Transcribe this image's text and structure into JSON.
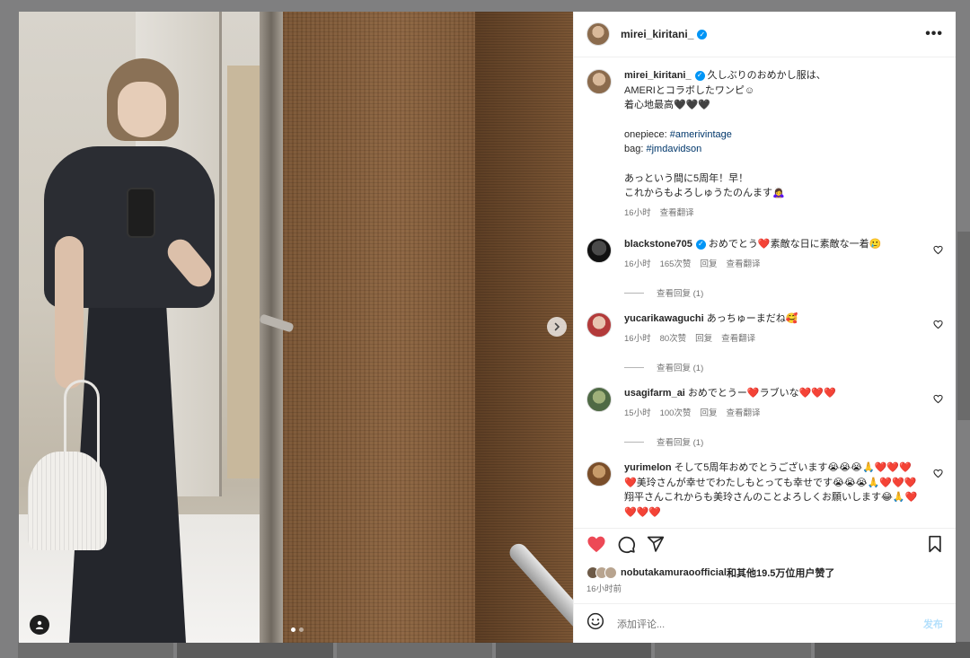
{
  "post": {
    "username": "mirei_kiritani_",
    "caption_lines": [
      "久しぶりのおめかし服は、",
      "AMERIとコラボしたワンピ☺︎",
      "着心地最高🖤🖤🖤"
    ],
    "credits": [
      {
        "label": "onepiece:",
        "tag": "#amerivintage"
      },
      {
        "label": "bag:",
        "tag": "#jmdavidson"
      }
    ],
    "caption_tail": [
      "あっという間に5周年！早！",
      "これからもよろしゅうたのんます🙇‍♀️"
    ],
    "caption_time": "16小时",
    "translate": "查看翻译",
    "likes_by": "nobutakamuraoofficial",
    "likes_rest": "和其他19.5万位用户赞了",
    "post_time": "16小时前"
  },
  "comments": [
    {
      "user": "blackstone705",
      "verified": true,
      "text": "おめでとう❤️素敵な日に素敵な一着🥲",
      "time": "16小时",
      "likes": "165次赞",
      "reply": "回复",
      "translate": "查看翻译",
      "view_replies": "查看回复 (1)"
    },
    {
      "user": "yucarikawaguchi",
      "verified": false,
      "text": "あっちゅーまだね🥰",
      "time": "16小时",
      "likes": "80次赞",
      "reply": "回复",
      "translate": "查看翻译",
      "view_replies": "查看回复 (1)"
    },
    {
      "user": "usagifarm_ai",
      "verified": false,
      "text": "おめでとうー❤️ラブいな❤️❤️❤️",
      "time": "15小时",
      "likes": "100次赞",
      "reply": "回复",
      "translate": "查看翻译",
      "view_replies": "查看回复 (1)"
    },
    {
      "user": "yurimelon",
      "verified": false,
      "text": "そして5周年おめでとうございます😭😭😭🙏❤️❤️❤️❤️美玲さんが幸せでわたしもとっても幸せです😭😭😭🙏❤️❤️❤️翔平さんこれからも美玲さんのことよろしくお願いします😂🙏❤️❤️❤️❤️"
    }
  ],
  "composer": {
    "placeholder": "添加评论...",
    "post_label": "发布"
  },
  "colors": {
    "like_red": "#ed4956",
    "link_blue": "#00376b",
    "verified_blue": "#0095f6"
  }
}
